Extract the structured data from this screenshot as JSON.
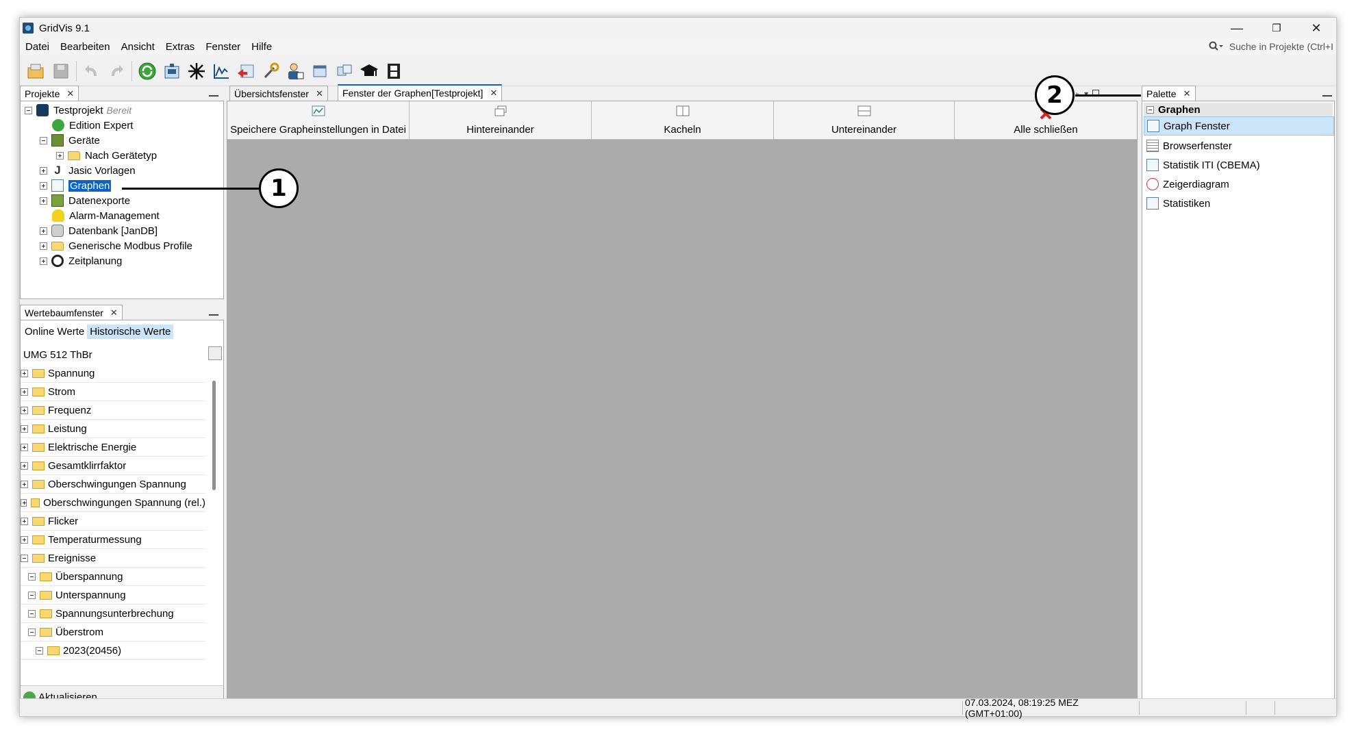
{
  "window": {
    "title": "GridVis 9.1",
    "minimize": "—",
    "maximize": "❐",
    "close": "✕"
  },
  "menu": [
    "Datei",
    "Bearbeiten",
    "Ansicht",
    "Extras",
    "Fenster",
    "Hilfe"
  ],
  "search": {
    "placeholder": "Suche in Projekte (Ctrl+I"
  },
  "projects_panel": {
    "tab": "Projekte",
    "root": {
      "label": "Testprojekt",
      "status": "Bereit"
    },
    "items": [
      {
        "label": "Edition Expert"
      },
      {
        "label": "Geräte"
      },
      {
        "label": "Nach Gerätetyp"
      },
      {
        "label": "Jasic Vorlagen"
      },
      {
        "label": "Graphen"
      },
      {
        "label": "Datenexporte"
      },
      {
        "label": "Alarm-Management"
      },
      {
        "label": "Datenbank [JanDB]"
      },
      {
        "label": "Generische Modbus Profile"
      },
      {
        "label": "Zeitplanung"
      }
    ]
  },
  "values_panel": {
    "tab": "Wertebaumfenster",
    "subtabs": [
      "Online Werte",
      "Historische Werte"
    ],
    "device": "UMG  512 ThBr",
    "items": [
      {
        "label": "Spannung"
      },
      {
        "label": "Strom"
      },
      {
        "label": "Frequenz"
      },
      {
        "label": "Leistung"
      },
      {
        "label": "Elektrische Energie"
      },
      {
        "label": "Gesamtklirrfaktor"
      },
      {
        "label": "Oberschwingungen Spannung"
      },
      {
        "label": "Oberschwingungen Spannung (rel.)"
      },
      {
        "label": "Flicker"
      },
      {
        "label": "Temperaturmessung"
      },
      {
        "label": "Ereignisse"
      },
      {
        "label": "Überspannung"
      },
      {
        "label": "Unterspannung"
      },
      {
        "label": "Spannungsunterbrechung"
      },
      {
        "label": "Überstrom"
      },
      {
        "label": "2023(20456)"
      }
    ],
    "refresh": "Aktualisieren"
  },
  "editor": {
    "tabs": [
      "Übersichtsfenster",
      "Fenster der Graphen[Testprojekt]"
    ],
    "buttons": [
      "Speichere Grapheinstellungen in Datei",
      "Hintereinander",
      "Kacheln",
      "Untereinander",
      "Alle schließen"
    ]
  },
  "palette": {
    "tab": "Palette",
    "group": "Graphen",
    "items": [
      "Graph Fenster",
      "Browserfenster",
      "Statistik ITI (CBEMA)",
      "Zeigerdiagram",
      "Statistiken"
    ]
  },
  "status": {
    "datetime": "07.03.2024, 08:19:25 MEZ (GMT+01:00)"
  },
  "callouts": [
    "1",
    "2"
  ],
  "colors": {
    "selection": "#0a64c8",
    "palette_selected": "#cce4f7",
    "workspace": "#ababab"
  }
}
